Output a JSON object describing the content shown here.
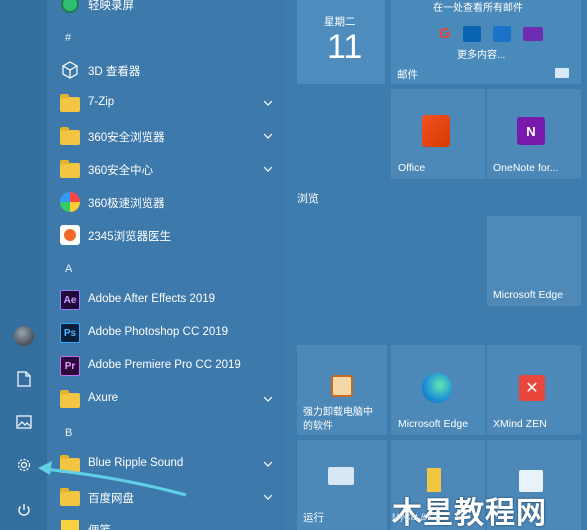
{
  "top_partial_item": "轻映录屏",
  "app_list": {
    "hash_header": "#",
    "items": [
      {
        "label": "3D 查看器"
      },
      {
        "label": "7-Zip"
      },
      {
        "label": "360安全浏览器"
      },
      {
        "label": "360安全中心"
      },
      {
        "label": "360极速浏览器"
      },
      {
        "label": "2345浏览器医生"
      }
    ],
    "a_header": "A",
    "a_items": [
      {
        "label": "Adobe After Effects 2019",
        "icon_text": "Ae"
      },
      {
        "label": "Adobe Photoshop CC 2019",
        "icon_text": "Ps"
      },
      {
        "label": "Adobe Premiere Pro CC 2019",
        "icon_text": "Pr"
      },
      {
        "label": "Axure"
      }
    ],
    "b_header": "B",
    "b_items": [
      {
        "label": "Blue Ripple Sound"
      },
      {
        "label": "百度网盘"
      },
      {
        "label": "便笺"
      }
    ]
  },
  "tiles": {
    "calendar_day": "星期二",
    "calendar_date": "11",
    "mail_header": "在一处查看所有邮件",
    "mail_more": "更多内容...",
    "mail_label": "邮件",
    "office_label": "Office",
    "onenote_label": "OneNote for...",
    "browse_section": "浏览",
    "edge_label_top": "Microsoft Edge",
    "uninstall_label_1": "强力卸载电脑中",
    "uninstall_label_2": "的软件",
    "edge_label_bottom": "Microsoft Edge",
    "xmind_label": "XMind ZEN",
    "run_label": "运行"
  },
  "watermark": {
    "main": "木星教程网",
    "small": "MyCat & Co..."
  },
  "colors": {
    "background": "#3f7cae",
    "tile": "#4c88b8",
    "folder": "#f2c542",
    "arrow": "#5fd0e6"
  }
}
